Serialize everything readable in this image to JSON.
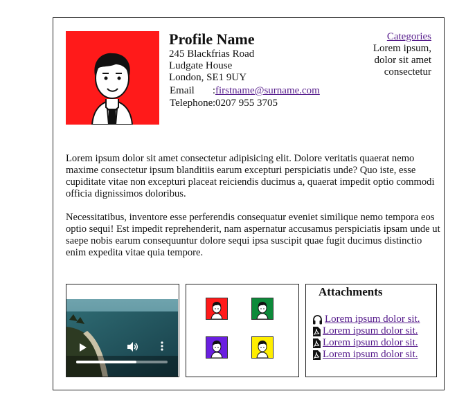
{
  "profile": {
    "name": "Profile Name",
    "address": [
      "245 Blackfrias Road",
      "Ludgate House",
      "London, SE1 9UY"
    ],
    "email_label": "Email",
    "email_sep": ":",
    "email": "firstname@surname.com",
    "phone_label": "Telephone",
    "phone_sep": ":",
    "phone": "0207 955 3705",
    "avatar_icon": "person-avatar-icon",
    "avatar_bg": "#ff1a1a"
  },
  "categories": {
    "link": "Categories",
    "text": "Lorem ipsum, dolor sit amet consectetur"
  },
  "body": {
    "p1": "Lorem ipsum dolor sit amet consectetur adipisicing elit. Dolore veritatis quaerat nemo maxime consectetur ipsum blanditiis earum excepturi perspiciatis unde? Quo iste, esse cupiditate vitae non excepturi placeat reiciendis ducimus a, quaerat impedit optio commodi officia dignissimos doloribus.",
    "p2": "Necessitatibus, inventore esse perferendis consequatur eveniet similique nemo tempora eos optio sequi! Est impedit reprehenderit, nam aspernatur accusamus perspiciatis ipsam unde ut saepe nobis earum consequuntur dolore sequi ipsa suscipit quae fugit ducimus distinctio enim expedita vitae quia tempore."
  },
  "video": {
    "progress": 0.66,
    "icons": [
      "play-icon",
      "volume-icon",
      "more-options-icon"
    ]
  },
  "thumbnails": [
    {
      "bg": "#ff1a1a",
      "icon": "person-avatar-icon"
    },
    {
      "bg": "#0d8a3a",
      "icon": "person-avatar-icon"
    },
    {
      "bg": "#6a1fe0",
      "icon": "person-avatar-icon"
    },
    {
      "bg": "#ffee00",
      "icon": "person-avatar-icon"
    }
  ],
  "attachments": {
    "title": "Attachments",
    "items": [
      {
        "icon": "headphones-icon",
        "label": "Lorem ipsum dolor sit."
      },
      {
        "icon": "pdf-file-icon",
        "label": "Lorem ipsum dolor sit."
      },
      {
        "icon": "pdf-file-icon",
        "label": "Lorem ipsum dolor sit."
      },
      {
        "icon": "pdf-file-icon",
        "label": "Lorem ipsum dolor sit."
      }
    ]
  }
}
